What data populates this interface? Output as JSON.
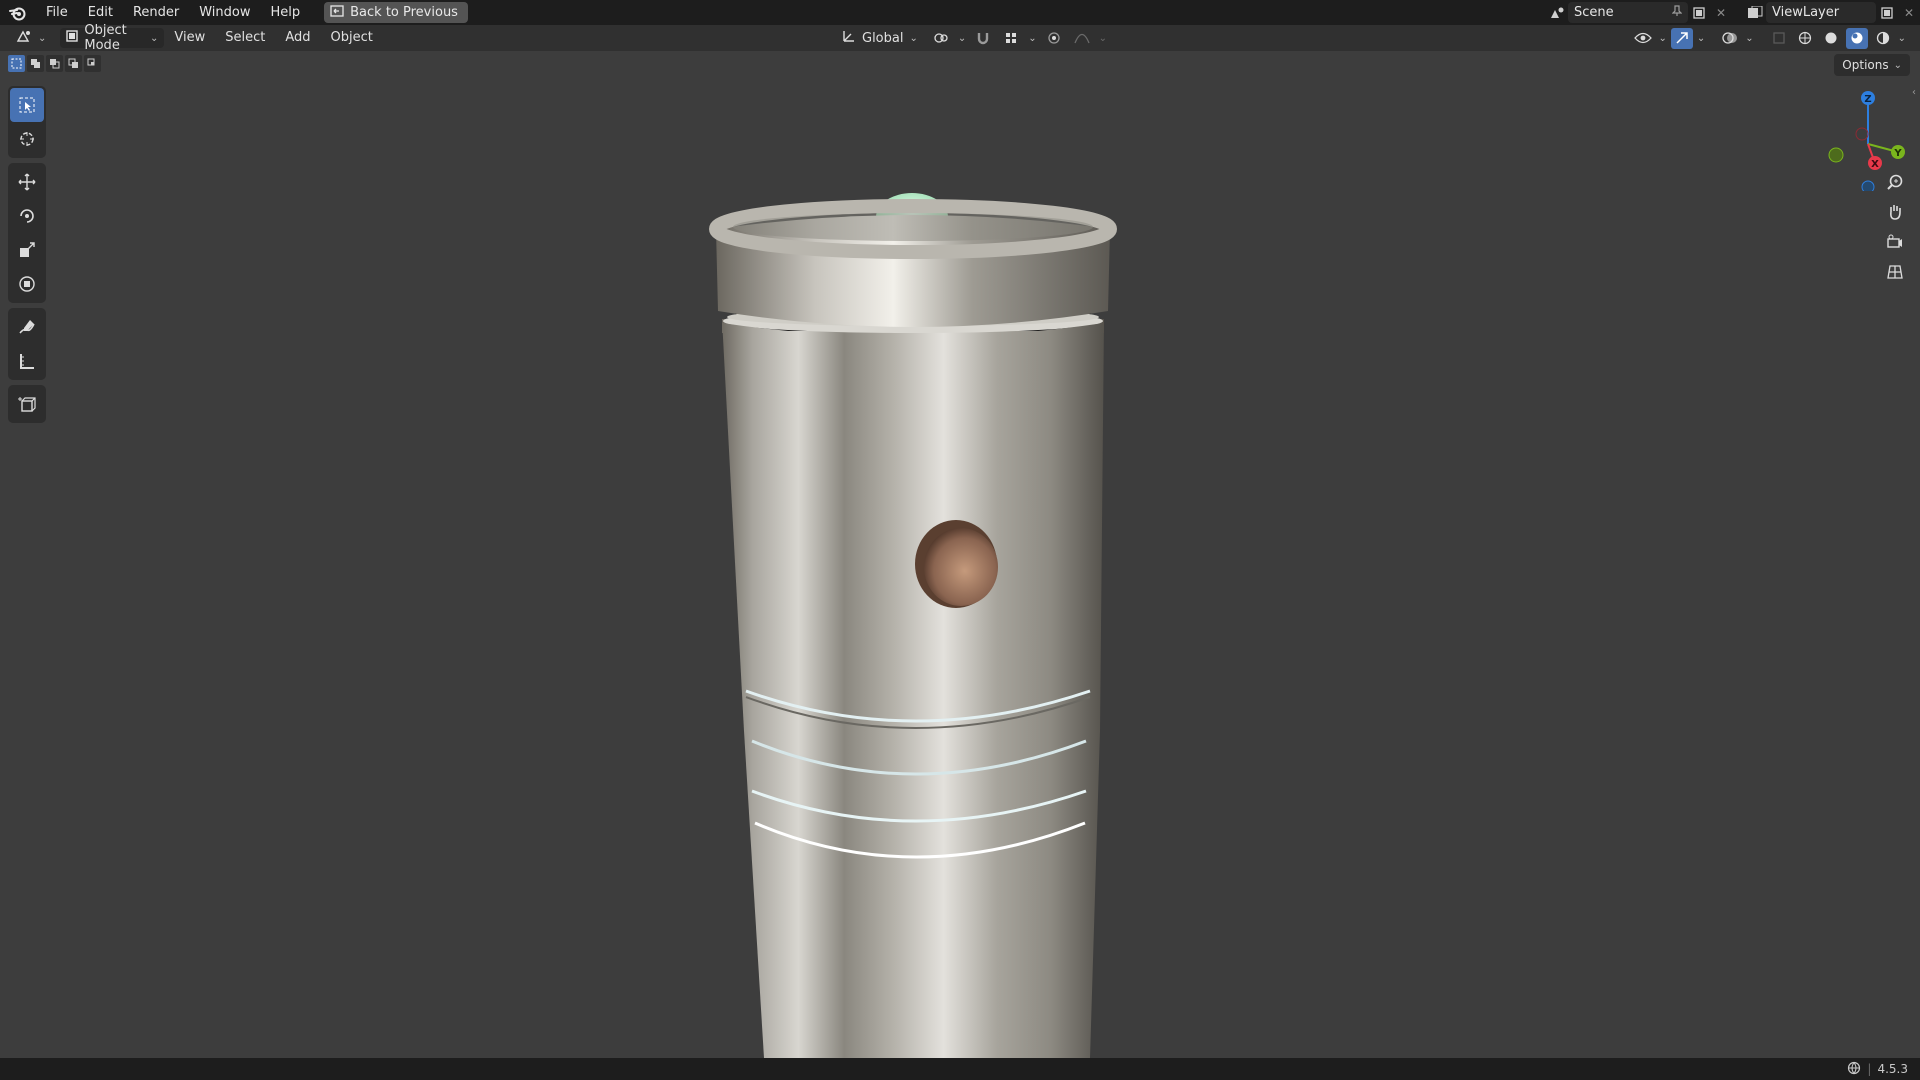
{
  "topbar": {
    "menus": [
      "File",
      "Edit",
      "Render",
      "Window",
      "Help"
    ],
    "back_button": "Back to Previous",
    "scene_name": "Scene",
    "view_layer_name": "ViewLayer"
  },
  "header": {
    "mode": "Object Mode",
    "menus": [
      "View",
      "Select",
      "Add",
      "Object"
    ],
    "transform_orientation": "Global"
  },
  "viewport": {
    "options_label": "Options",
    "gizmo_axes": [
      "Z",
      "Y",
      "X"
    ],
    "tools": [
      "select-box",
      "cursor",
      "move",
      "rotate",
      "scale",
      "transform",
      "annotate",
      "measure",
      "add-cube"
    ]
  },
  "status": {
    "version": "4.5.3"
  },
  "colors": {
    "accent": "#4772b3",
    "axis_x": "#e8394a",
    "axis_y": "#7ab51d",
    "axis_z": "#2d7fe0"
  }
}
